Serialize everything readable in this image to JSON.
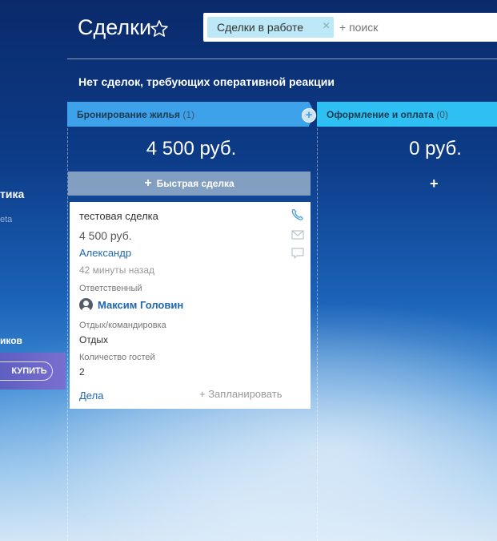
{
  "sidebar": {
    "line1": "тика",
    "line2": "eta",
    "line3": "иков",
    "buy_label": "КУПИТЬ"
  },
  "header": {
    "title": "Сделки",
    "filter_chip": "Сделки в работе",
    "search_placeholder": "+ поиск"
  },
  "notice": "Нет сделок, требующих оперативной реакции",
  "stages": [
    {
      "name": "Бронирование жилья",
      "count": "(1)",
      "sum": "4 500 руб.",
      "quick_deal": "Быстрая сделка"
    },
    {
      "name": "Оформление и оплата",
      "count": "(0)",
      "sum": "0 руб.",
      "add": "+"
    }
  ],
  "card": {
    "title": "тестовая сделка",
    "sum": "4 500 руб.",
    "contact": "Александр",
    "time": "42 минуты назад",
    "responsible_label": "Ответственный",
    "responsible_name": "Максим Головин",
    "field1_label": "Отдых/командировка",
    "field1_value": "Отдых",
    "field2_label": "Количество гостей",
    "field2_value": "2",
    "deals_link": "Дела",
    "plan_link": "+ Запланировать"
  },
  "colors": {
    "stage1": "#3ea2ea",
    "stage2": "#2ec0f3",
    "link": "#2067b0"
  }
}
